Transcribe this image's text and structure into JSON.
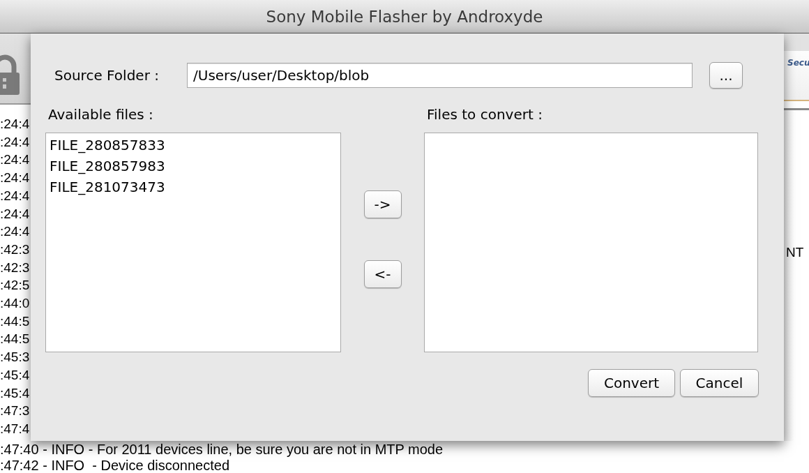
{
  "window": {
    "title": "Sony Mobile Flasher by Androxyde"
  },
  "background": {
    "toolbar_fragment": "Secu",
    "log_left": [
      ":24:4",
      ":24:4",
      ":24:4",
      ":24:4",
      ":24:4",
      ":24:4",
      ":24:4",
      ":42:3",
      ":42:3",
      ":42:5",
      ":44:0",
      ":44:5",
      ":44:5",
      ":45:3",
      ":45:4",
      ":45:4",
      ":47:3",
      ":47:4"
    ],
    "log_right_fragment": "NT",
    "log_bottom": [
      ":47:40 - INFO - For 2011 devices line, be sure you are not in MTP mode",
      ":47:42 - INFO  - Device disconnected"
    ]
  },
  "dialog": {
    "source_folder": {
      "label": "Source Folder :",
      "value": "/Users/user/Desktop/blob",
      "browse_button": "..."
    },
    "available_files": {
      "label": "Available files :",
      "items": [
        {
          "name": "FILE_280857833",
          "selected": false
        },
        {
          "name": "FILE_280857983",
          "selected": false
        },
        {
          "name": "FILE_281073473",
          "selected": false
        }
      ]
    },
    "move_buttons": [
      "->",
      "<-"
    ],
    "files_to_convert": {
      "label": "Files to convert :"
    },
    "buttons": [
      "Convert",
      "Cancel"
    ]
  }
}
